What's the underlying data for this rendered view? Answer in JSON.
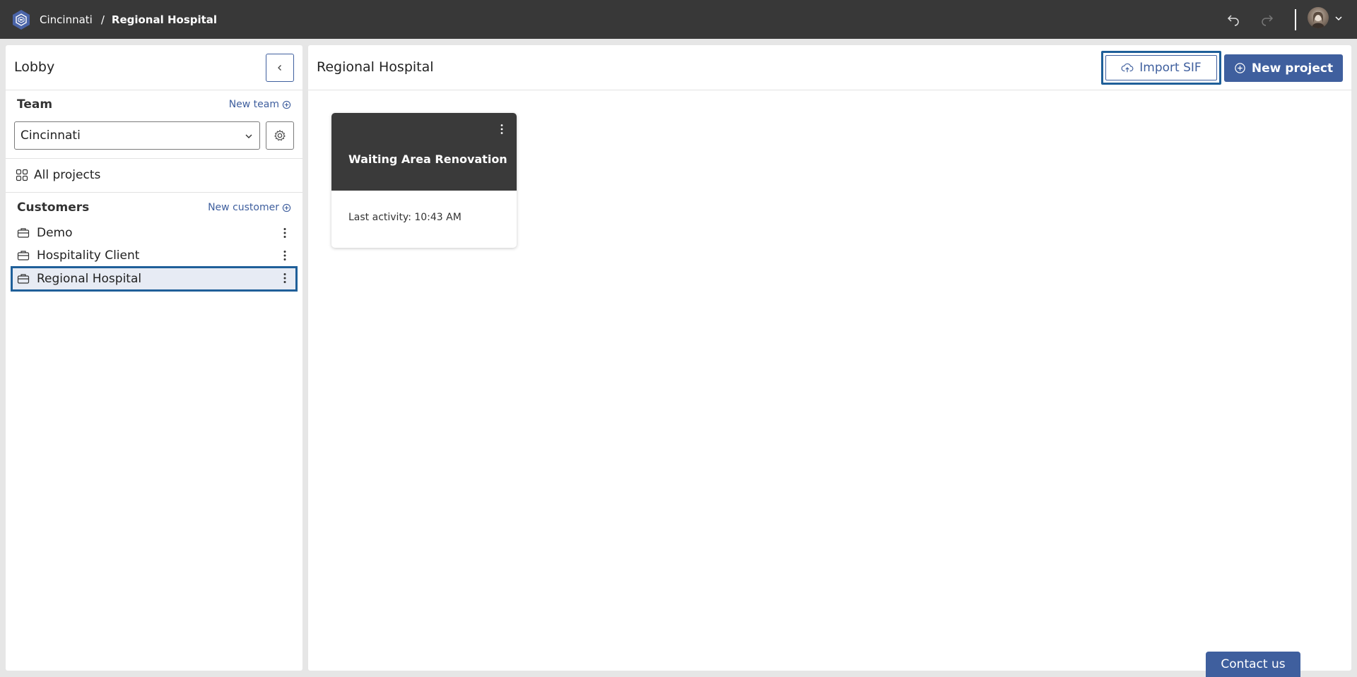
{
  "topbar": {
    "breadcrumb": [
      "Cincinnati",
      "Regional Hospital"
    ],
    "separator": "/"
  },
  "sidebar": {
    "title": "Lobby",
    "team_label": "Team",
    "new_team_label": "New team",
    "team_selected": "Cincinnati",
    "all_projects_label": "All projects",
    "customers_label": "Customers",
    "new_customer_label": "New customer",
    "customers": [
      {
        "label": "Demo"
      },
      {
        "label": "Hospitality Client"
      },
      {
        "label": "Regional Hospital"
      }
    ]
  },
  "main": {
    "title": "Regional Hospital",
    "import_label": "Import SIF",
    "new_project_label": "New project",
    "projects": [
      {
        "title": "Waiting Area Renovation",
        "meta": "Last activity: 10:43 AM"
      }
    ]
  },
  "contact_label": "Contact us",
  "colors": {
    "topbar_bg": "#383838",
    "accent": "#3f5f9e",
    "focus_outline": "#1f5f99",
    "selected_bg": "#e7ebf4",
    "card_header": "#3a3a3a"
  }
}
